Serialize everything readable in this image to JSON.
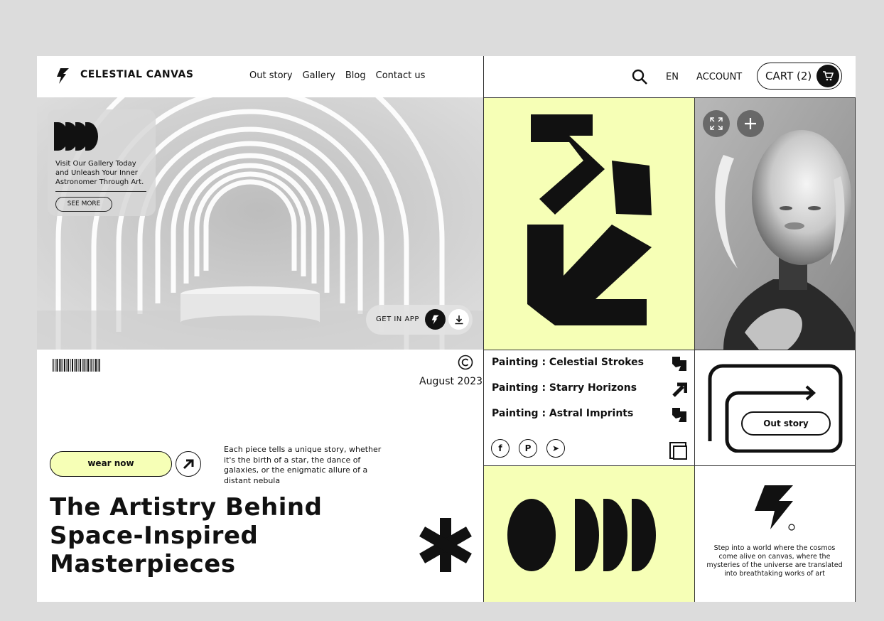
{
  "header": {
    "brand": "CELESTIAL CANVAS",
    "nav": [
      "Out story",
      "Gallery",
      "Blog",
      "Contact us"
    ],
    "lang": "EN",
    "account": "ACCOUNT",
    "cart_label": "CART (2)"
  },
  "hero": {
    "card_text": "Visit Our Gallery Today and Unleash Your Inner Astronomer Through Art.",
    "see_more": "SEE MORE",
    "app_label": "GET IN APP"
  },
  "info": {
    "date": "August 2023",
    "wear_now": "wear now",
    "description": "Each piece tells a unique story, whether it's the birth of a star, the dance of galaxies, or the enigmatic allure of a distant nebula",
    "headline_lines": [
      "The Artistry Behind",
      "Space-Inspired",
      "Masterpieces"
    ]
  },
  "paintings": [
    "Painting : Celestial Strokes",
    "Painting : Starry Horizons",
    "Painting : Astral Imprints"
  ],
  "social": [
    "f",
    "P",
    "➤"
  ],
  "story_button": "Out story",
  "footer_text": "Step into a world where the cosmos come alive on canvas, where the mysteries of the universe are translated into breathtaking works of art",
  "colors": {
    "accent": "#f6ffb6",
    "ink": "#111111"
  }
}
